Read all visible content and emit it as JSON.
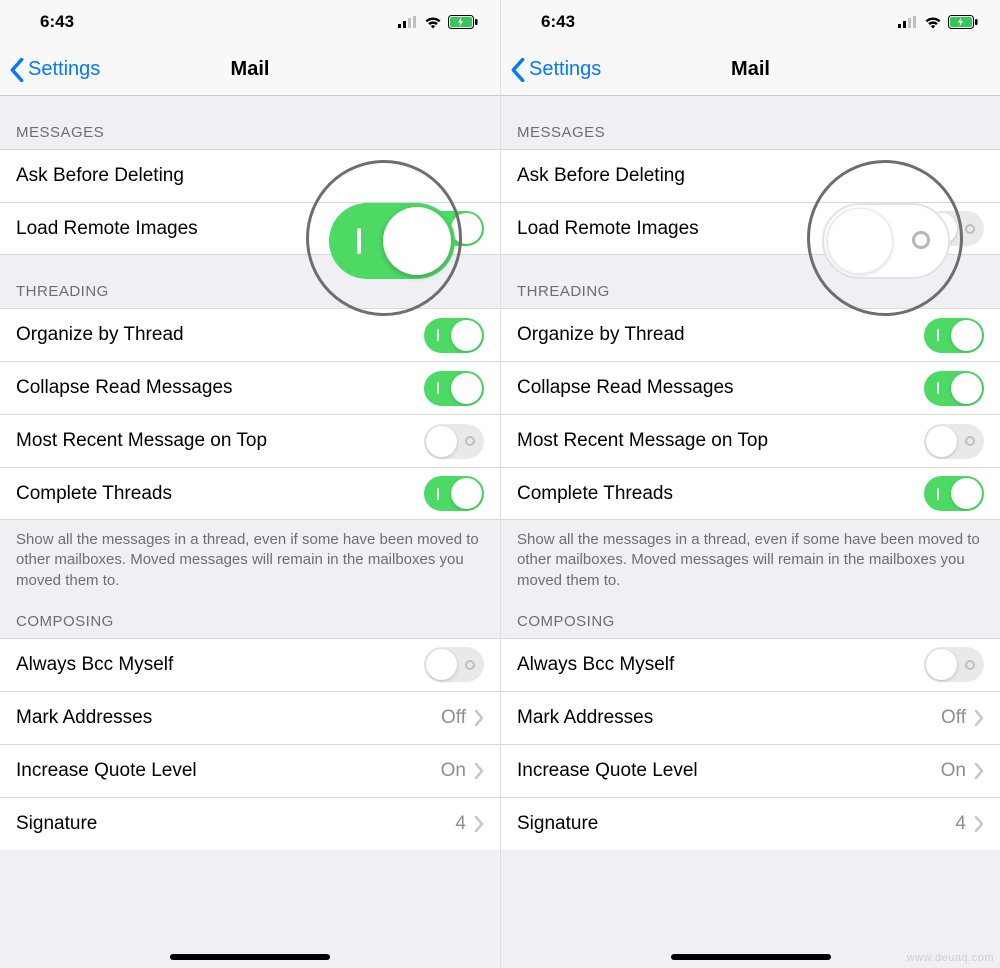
{
  "status": {
    "time": "6:43"
  },
  "nav": {
    "back": "Settings",
    "title": "Mail"
  },
  "sections": {
    "messages": {
      "header": "MESSAGES",
      "ask_before_deleting": "Ask Before Deleting",
      "load_remote_images": "Load Remote Images"
    },
    "threading": {
      "header": "THREADING",
      "organize_by_thread": "Organize by Thread",
      "collapse_read": "Collapse Read Messages",
      "most_recent_top": "Most Recent Message on Top",
      "complete_threads": "Complete Threads",
      "footer": "Show all the messages in a thread, even if some have been moved to other mailboxes. Moved messages will remain in the mailboxes you moved them to."
    },
    "composing": {
      "header": "COMPOSING",
      "always_bcc": "Always Bcc Myself",
      "mark_addresses": "Mark Addresses",
      "mark_addresses_value": "Off",
      "increase_quote": "Increase Quote Level",
      "increase_quote_value": "On",
      "signature": "Signature",
      "signature_value": "4"
    }
  },
  "toggles": {
    "left": {
      "load_remote_images": true,
      "organize_by_thread": true,
      "collapse_read": true,
      "most_recent_top": false,
      "complete_threads": true,
      "always_bcc": false
    },
    "right": {
      "load_remote_images": false,
      "organize_by_thread": true,
      "collapse_read": true,
      "most_recent_top": false,
      "complete_threads": true,
      "always_bcc": false
    }
  },
  "watermark": "www.deuaq.com"
}
